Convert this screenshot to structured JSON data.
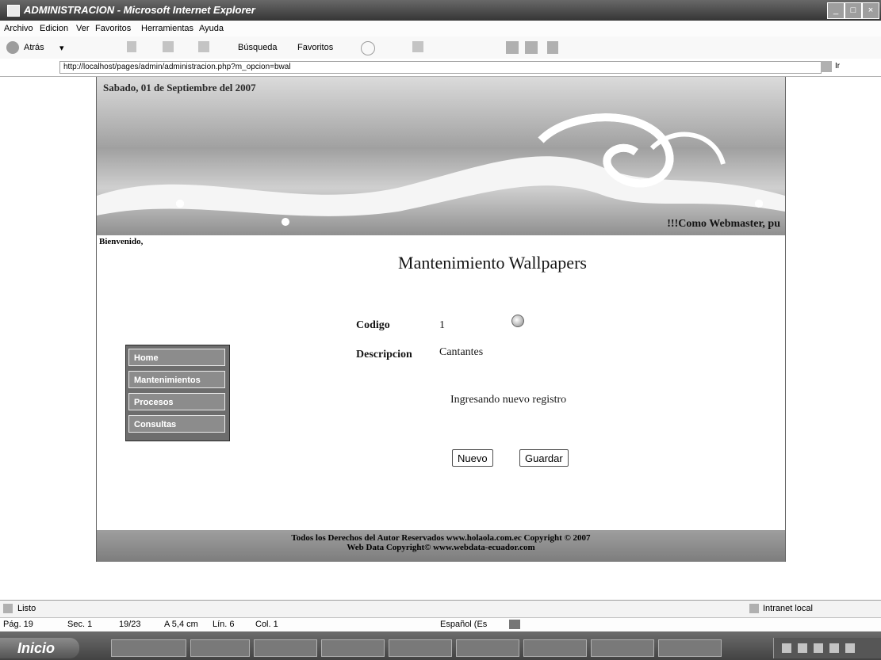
{
  "window": {
    "title": "ADMINISTRACION - Microsoft Internet Explorer"
  },
  "menu": [
    "Archivo",
    "Edicion",
    "Ver",
    "Favoritos",
    "Herramientas",
    "Ayuda"
  ],
  "toolbar": {
    "back_label": "Atrás",
    "search_label": "Búsqueda",
    "favorites_label": "Favoritos"
  },
  "address": {
    "url": "http://localhost/pages/admin/administracion.php?m_opcion=bwal",
    "go_label": "Ir"
  },
  "page": {
    "date": "Sabado, 01 de Septiembre del 2007",
    "banner_tag": "!!!Como Webmaster, pu",
    "welcome": "Bienvenido,",
    "title": "Mantenimiento Wallpapers",
    "menu_items": [
      "Home",
      "Mantenimientos",
      "Procesos",
      "Consultas"
    ],
    "form": {
      "codigo_label": "Codigo",
      "codigo_value": "1",
      "descripcion_label": "Descripcion",
      "descripcion_value": "Cantantes",
      "status_message": "Ingresando nuevo registro",
      "nuevo_label": "Nuevo",
      "guardar_label": "Guardar"
    },
    "footer_line1": "Todos los Derechos del Autor Reservados www.holaola.com.ec Copyright © 2007",
    "footer_line2": "Web Data Copyright© www.webdata-ecuador.com"
  },
  "status": {
    "left": "Listo",
    "zone": "Intranet local"
  },
  "word_status": {
    "pag": "Pág. 19",
    "sec": "Sec. 1",
    "pages": "19/23",
    "pos": "A 5,4 cm",
    "lin": "Lín. 6",
    "col": "Col. 1",
    "lang": "Español (Es"
  },
  "taskbar": {
    "start": "Inicio"
  }
}
